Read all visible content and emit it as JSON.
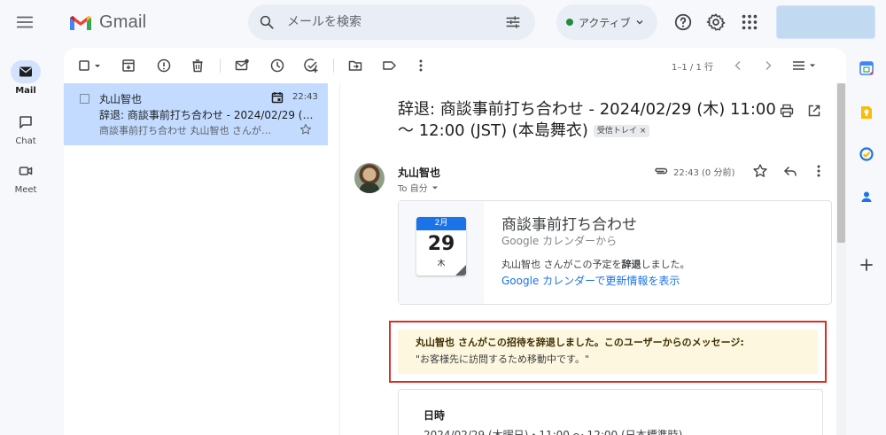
{
  "header": {
    "app_name": "Gmail",
    "search_placeholder": "メールを検索",
    "status_label": "アクティブ"
  },
  "rail": {
    "items": [
      {
        "label": "Mail",
        "icon": "mail-icon",
        "active": true
      },
      {
        "label": "Chat",
        "icon": "chat-icon",
        "active": false
      },
      {
        "label": "Meet",
        "icon": "meet-icon",
        "active": false
      }
    ]
  },
  "toolbar": {
    "pager_text": "1–1 / 1 行"
  },
  "list": {
    "rows": [
      {
        "sender": "丸山智也",
        "time": "22:43",
        "subject": "辞退: 商談事前打ち合わせ - 2024/02/29 (木) 11:00 〜 12:00 (JST)",
        "snippet": "商談事前打ち合わせ 丸山智也 さんが…"
      }
    ]
  },
  "message": {
    "subject": "辞退: 商談事前打ち合わせ - 2024/02/29 (木) 11:00 〜 12:00 (JST) (本島舞衣)",
    "label": "受信トレイ",
    "label_remove": "×",
    "from_name": "丸山智也",
    "to_text": "To 自分",
    "time_text": "22:43 (0 分前)"
  },
  "invite": {
    "month": "2月",
    "day": "29",
    "weekday": "木",
    "title": "商談事前打ち合わせ",
    "source": "Google カレンダーから",
    "message_prefix": "丸山智也 さんがこの予定を",
    "message_strong": "辞退",
    "message_suffix": "しました。",
    "link": "Google カレンダーで更新情報を表示"
  },
  "note": {
    "strong": "丸山智也 さんがこの招待を辞退しました。このユーザーからのメッセージ:",
    "text": "\"お客様先に訪問するため移動中です。\""
  },
  "date_card": {
    "label": "日時",
    "value": "2024/02/29 (木曜日)・11:00 〜 12:00 (日本標準時)"
  },
  "colors": {
    "accent_blue": "#1a73e8",
    "selected_row": "#c2dbff",
    "highlight_border": "#d93025",
    "note_bg": "#fef7e0",
    "status_green": "#1e8e3e"
  }
}
